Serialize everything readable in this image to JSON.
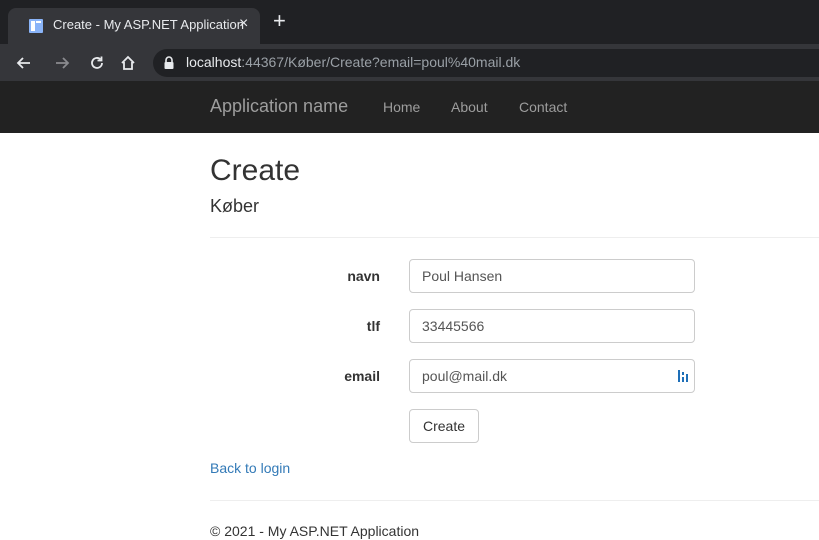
{
  "browser": {
    "tab_title": "Create - My ASP.NET Application",
    "tab_close": "×",
    "new_tab": "+",
    "url_host": "localhost",
    "url_rest": ":44367/Køber/Create?email=poul%40mail.dk",
    "icons": {
      "back": "arrow-left-icon",
      "forward": "arrow-right-icon",
      "reload": "reload-icon",
      "home": "home-icon",
      "lock": "lock-icon",
      "favicon": "page-icon"
    }
  },
  "navbar": {
    "brand": "Application name",
    "links": [
      "Home",
      "About",
      "Contact"
    ]
  },
  "page": {
    "title": "Create",
    "subtitle": "Køber"
  },
  "form": {
    "fields": [
      {
        "label": "navn",
        "value": "Poul Hansen"
      },
      {
        "label": "tlf",
        "value": "33445566"
      },
      {
        "label": "email",
        "value": "poul@mail.dk"
      }
    ],
    "submit_label": "Create"
  },
  "back_link": "Back to login",
  "footer": "© 2021 - My ASP.NET Application",
  "colors": {
    "tabstrip": "#202124",
    "toolbar": "#35363a",
    "navbar": "#222222",
    "navbar_text": "#9d9d9d",
    "link": "#337ab7"
  }
}
